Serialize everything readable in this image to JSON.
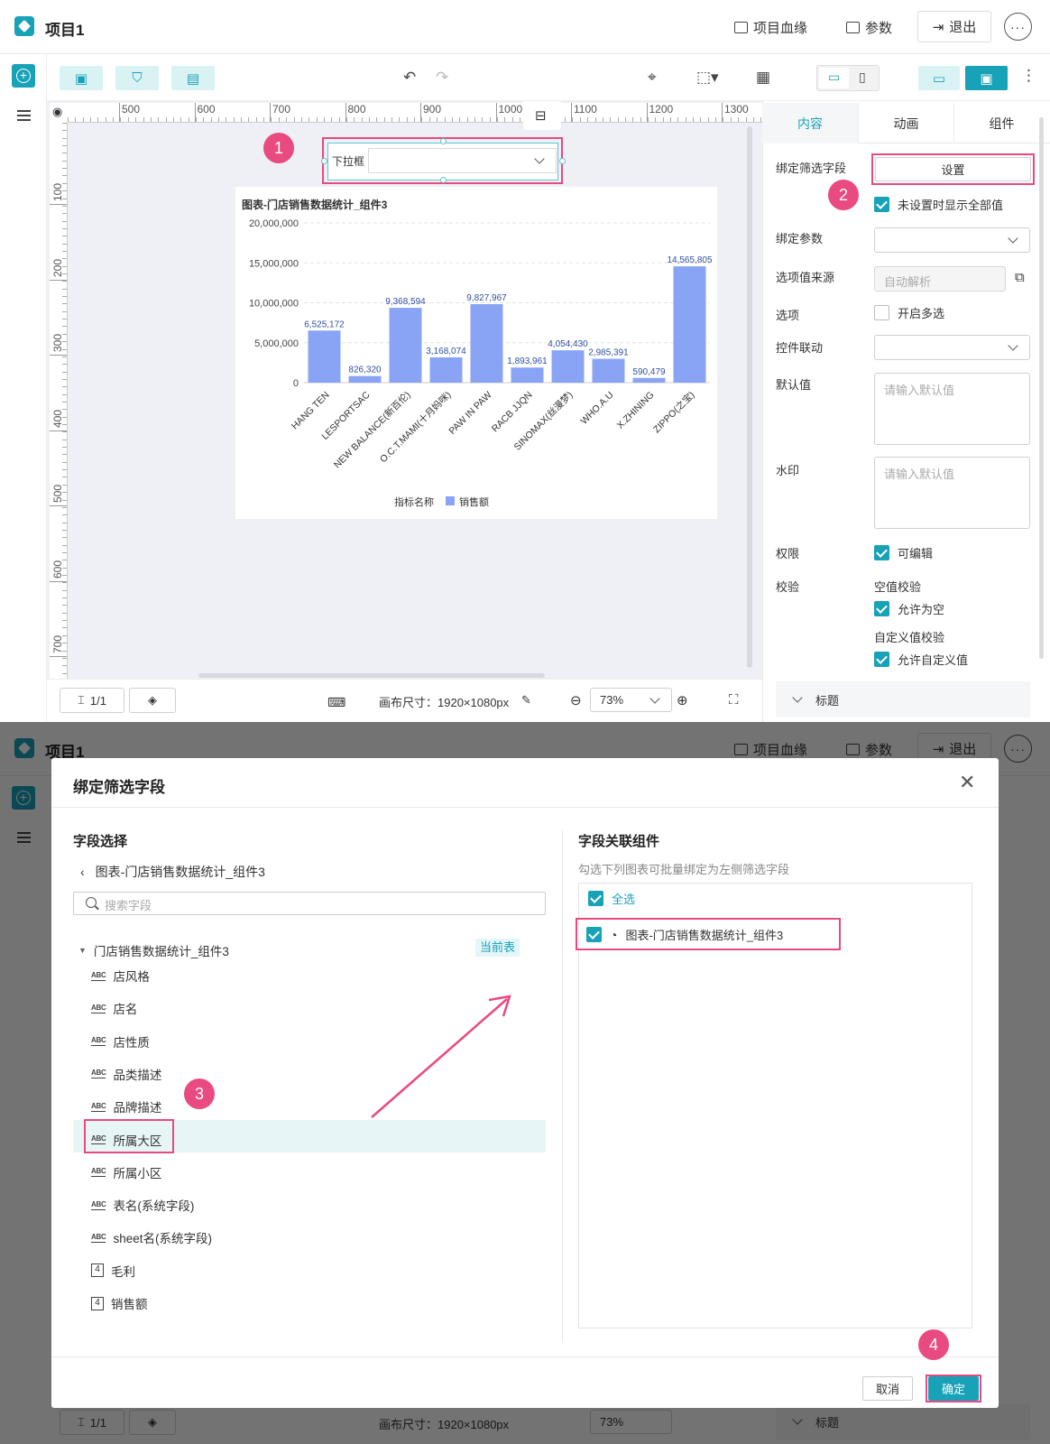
{
  "app": {
    "project_title": "项目1",
    "lineage": "项目血缘",
    "params": "参数",
    "exit": "退出"
  },
  "ruler": {
    "h_ticks": [
      "500",
      "600",
      "700",
      "800",
      "900",
      "1000",
      "1100",
      "1200",
      "1300"
    ],
    "v_ticks": [
      "100",
      "200",
      "300",
      "400",
      "500",
      "600",
      "700"
    ]
  },
  "dropdown_widget": {
    "label": "下拉框"
  },
  "badges": [
    "1",
    "2",
    "3",
    "4"
  ],
  "chart_data": {
    "type": "bar",
    "title": "图表-门店销售数据统计_组件3",
    "categories": [
      "HANG TEN",
      "LESPORTSAC",
      "NEW BALANCE(新百伦)",
      "O.C.T.MAMI(十月妈咪)",
      "PAW IN PAW",
      "RACB JJQN",
      "SINOMAX(丝漫梦)",
      "WHO.A.U",
      "X.ZHINING",
      "ZIPPO(之宝)"
    ],
    "series": [
      {
        "name": "销售额",
        "values": [
          6525172,
          826320,
          9368594,
          3168074,
          9827967,
          1893961,
          4054430,
          2985391,
          590479,
          14565805
        ]
      }
    ],
    "value_labels": [
      "6,525,172",
      "826,320",
      "9,368,594",
      "3,168,074",
      "9,827,967",
      "1,893,961",
      "4,054,430",
      "2,985,391",
      "590,479",
      "14,565,805"
    ],
    "y_ticks": [
      "0",
      "5,000,000",
      "10,000,000",
      "15,000,000",
      "20,000,000"
    ],
    "ylim": [
      0,
      20000000
    ],
    "legend_title": "指标名称",
    "legend_position": "bottom",
    "color": "#8aa4f5",
    "grid": true
  },
  "right_panel": {
    "tabs": [
      "内容",
      "动画",
      "组件"
    ],
    "bind_field_label": "绑定筛选字段",
    "set_button": "设置",
    "show_all_when_unset": "未设置时显示全部值",
    "bind_param_label": "绑定参数",
    "option_source_label": "选项值来源",
    "option_source_value": "自动解析",
    "options_label": "选项",
    "multi_select": "开启多选",
    "control_link_label": "控件联动",
    "default_label": "默认值",
    "default_placeholder": "请输入默认值",
    "watermark_label": "水印",
    "watermark_placeholder": "请输入默认值",
    "permission_label": "权限",
    "editable": "可编辑",
    "validate_label": "校验",
    "empty_validate": "空值校验",
    "allow_empty": "允许为空",
    "custom_validate": "自定义值校验",
    "allow_custom": "允许自定义值",
    "title_section": "标题"
  },
  "bottom_bar": {
    "pages": "1/1",
    "canvas_size": "画布尺寸：1920×1080px",
    "zoom": "73%"
  },
  "modal": {
    "title": "绑定筛选字段",
    "left_title": "字段选择",
    "breadcrumb": "图表-门店销售数据统计_组件3",
    "search_placeholder": "搜索字段",
    "table_name": "门店销售数据统计_组件3",
    "current_table": "当前表",
    "fields": [
      {
        "type": "text",
        "name": "店风格"
      },
      {
        "type": "text",
        "name": "店名"
      },
      {
        "type": "text",
        "name": "店性质"
      },
      {
        "type": "text",
        "name": "品类描述"
      },
      {
        "type": "text",
        "name": "品牌描述"
      },
      {
        "type": "text",
        "name": "所属大区"
      },
      {
        "type": "text",
        "name": "所属小区"
      },
      {
        "type": "text",
        "name": "表名(系统字段)"
      },
      {
        "type": "text",
        "name": "sheet名(系统字段)"
      },
      {
        "type": "number",
        "name": "毛利"
      },
      {
        "type": "number",
        "name": "销售额"
      }
    ],
    "abc_glyph": "ABC",
    "num_glyph": "4",
    "right_title": "字段关联组件",
    "right_hint": "勾选下列图表可批量绑定为左侧筛选字段",
    "select_all": "全选",
    "chart_item": "图表-门店销售数据统计_组件3",
    "cancel": "取消",
    "ok": "确定"
  }
}
